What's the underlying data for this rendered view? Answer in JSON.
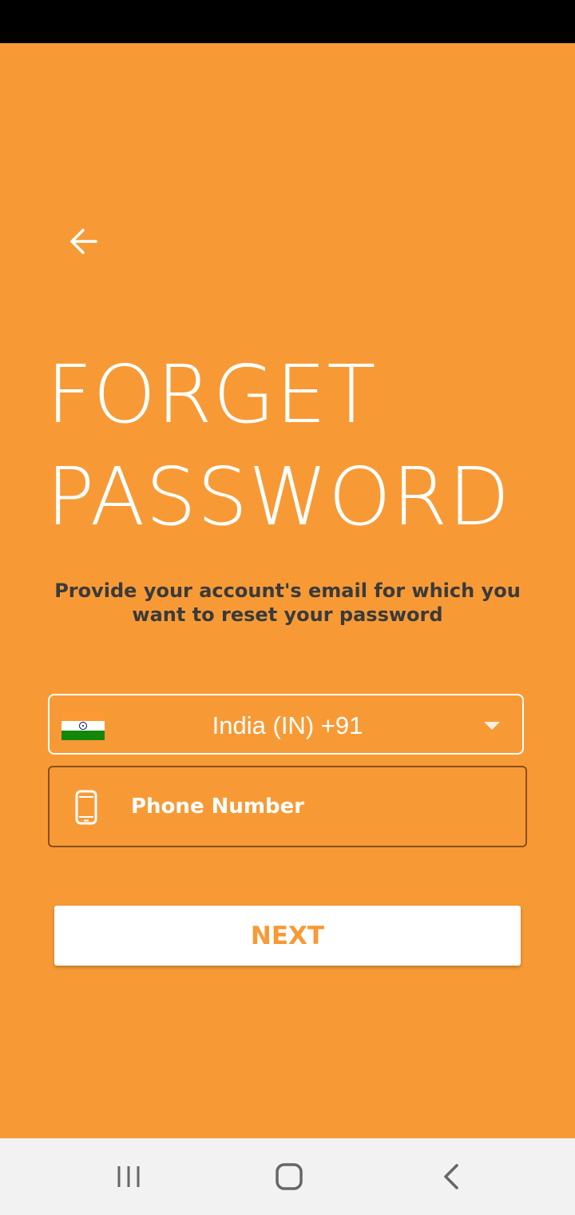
{
  "colors": {
    "background": "#F79A36",
    "status_bar": "#000000",
    "title_text": "#FFFFFF",
    "subtitle_text": "#3A3A3A",
    "phone_border": "#8A4E14",
    "button_bg": "#FFFFFF",
    "button_text": "#F79A36",
    "nav_bar": "#F2F2F2"
  },
  "header": {
    "back_icon": "arrow-left-icon",
    "title_line1": "FORGET",
    "title_line2": "PASSWORD",
    "subtitle": "Provide your account's email for which you want to reset your password"
  },
  "form": {
    "country": {
      "flag_icon": "india-flag-icon",
      "label": "India (IN)  +91",
      "dropdown_icon": "caret-down-icon"
    },
    "phone": {
      "icon": "smartphone-icon",
      "placeholder": "Phone Number"
    },
    "next_label": "NEXT"
  },
  "system_nav": {
    "recents_icon": "recent-apps-icon",
    "home_icon": "home-icon",
    "back_icon": "back-chevron-icon"
  }
}
